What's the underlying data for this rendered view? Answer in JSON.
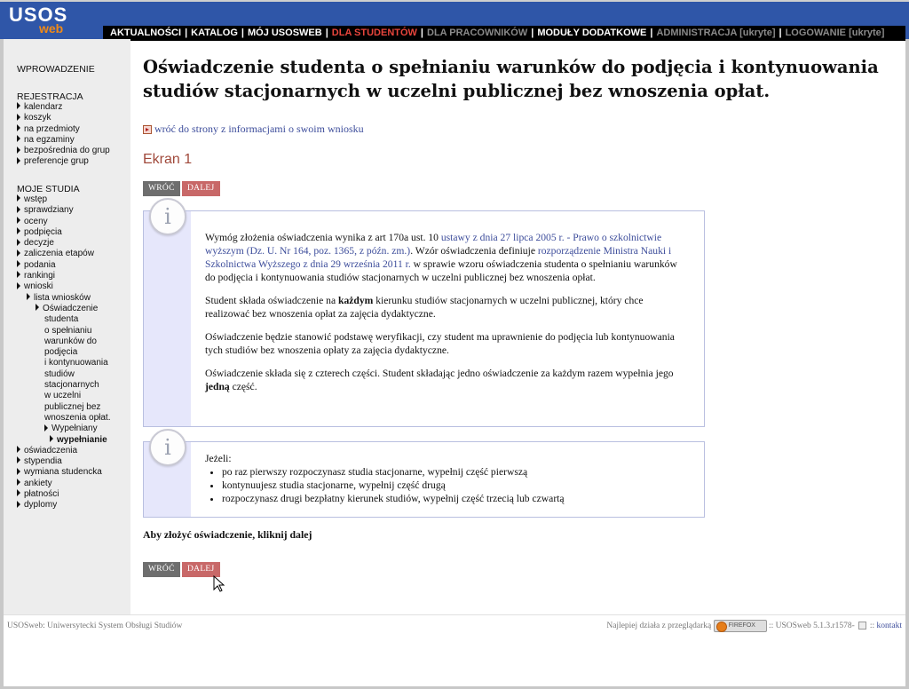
{
  "logo": {
    "main": "USOS",
    "sub": "web"
  },
  "nav": [
    {
      "label": "AKTUALNOŚCI",
      "state": "normal"
    },
    {
      "label": "KATALOG",
      "state": "normal"
    },
    {
      "label": "MÓJ USOSWEB",
      "state": "normal"
    },
    {
      "label": "DLA STUDENTÓW",
      "state": "active"
    },
    {
      "label": "DLA PRACOWNIKÓW",
      "state": "dim"
    },
    {
      "label": "MODUŁY DODATKOWE",
      "state": "normal"
    },
    {
      "label": "ADMINISTRACJA [ukryte]",
      "state": "dim"
    },
    {
      "label": "LOGOWANIE [ukryte]",
      "state": "dim"
    }
  ],
  "sidebar": {
    "intro": "WPROWADZENIE",
    "registration": {
      "heading": "REJESTRACJA",
      "items": [
        "kalendarz",
        "koszyk",
        "na przedmioty",
        "na egzaminy",
        "bezpośrednia do grup",
        "preferencje grup"
      ]
    },
    "studies": {
      "heading": "MOJE STUDIA",
      "items_top": [
        "wstęp",
        "sprawdziany",
        "oceny",
        "podpięcia",
        "decyzje",
        "zaliczenia etapów",
        "podania",
        "rankingi",
        "wnioski"
      ],
      "sub1": "lista wniosków",
      "sub2_lines": [
        "Oświadczenie",
        "studenta",
        "o spełnianiu",
        "warunków do",
        "podjęcia",
        "i kontynuowania",
        "studiów",
        "stacjonarnych",
        "w uczelni",
        "publicznej bez",
        "wnoszenia opłat."
      ],
      "sub3": "Wypełniany",
      "sub4": "wypełnianie",
      "items_bottom": [
        "oświadczenia",
        "stypendia",
        "wymiana studencka",
        "ankiety",
        "płatności",
        "dyplomy"
      ]
    }
  },
  "main": {
    "title": "Oświadczenie studenta o spełnianiu warunków do podjęcia i kontynuowania studiów stacjonarnych w uczelni publicznej bez wnoszenia opłat.",
    "back_link": "wróć do strony z informacjami o swoim wniosku",
    "screen_title": "Ekran 1",
    "btn_back": "WRÓĆ",
    "btn_next": "DALEJ",
    "info1": {
      "p1_a": "Wymóg złożenia oświadczenia wynika z art 170a ust. 10 ",
      "p1_link1": "ustawy z dnia 27 lipca 2005 r. - Prawo o szkolnictwie wyższym (Dz. U. Nr 164, poz. 1365, z późn. zm.)",
      "p1_b": ". Wzór oświadczenia definiuje ",
      "p1_link2": "rozporządzenie Ministra Nauki i Szkolnictwa Wyższego z dnia 29 września 2011 r.",
      "p1_c": " w sprawie wzoru oświadczenia studenta o spełnianiu warunków do podjęcia i kontynuowania studiów stacjonarnych w uczelni publicznej bez wnoszenia opłat.",
      "p2_a": "Student składa oświadczenie na ",
      "p2_bold": "każdym",
      "p2_b": " kierunku studiów stacjonarnych w uczelni publicznej, który chce realizować bez wnoszenia opłat za zajęcia dydaktyczne.",
      "p3": "Oświadczenie będzie stanowić podstawę weryfikacji, czy student ma uprawnienie do podjęcia lub kontynuowania tych studiów bez wnoszenia opłaty za zajęcia dydaktyczne.",
      "p4_a": "Oświadczenie składa się z czterech części. Student składając jedno oświadczenie za każdym razem wypełnia jego ",
      "p4_bold": "jedną",
      "p4_b": " część."
    },
    "info2": {
      "intro": "Jeżeli:",
      "items": [
        "po raz pierwszy rozpoczynasz studia stacjonarne, wypełnij część pierwszą",
        "kontynuujesz studia stacjonarne, wypełnij część drugą",
        "rozpoczynasz drugi bezpłatny kierunek studiów, wypełnij część trzecią lub czwartą"
      ]
    },
    "final_note": "Aby złożyć oświadczenie, kliknij dalej"
  },
  "footer": {
    "left": "USOSweb: Uniwersytecki System Obsługi Studiów",
    "right_prefix": "Najlepiej działa z przeglądarką",
    "badge": "FIREFOX",
    "version": ":: USOSweb 5.1.3.r1578-",
    "contact_sep": "::",
    "contact": "kontakt"
  },
  "icons": {
    "info": "info-icon",
    "back": "back-arrow-icon",
    "cursor": "mouse-pointer-icon",
    "bullet": "triangle-bullet-icon"
  },
  "colors": {
    "header": "#2f56a8",
    "active_nav": "#e8453c",
    "btn_next": "#c86868",
    "btn_back": "#6e6e6e",
    "link": "#3d4d9b",
    "screen_title": "#a0493b"
  }
}
